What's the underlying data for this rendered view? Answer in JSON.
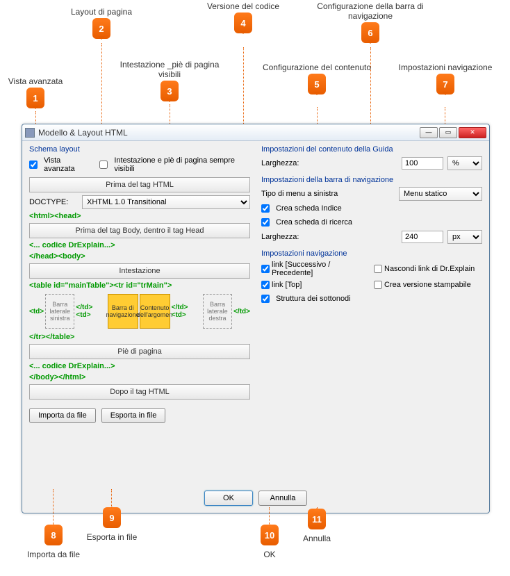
{
  "callouts": {
    "c1": {
      "num": "1",
      "label": "Vista avanzata"
    },
    "c2": {
      "num": "2",
      "label": "Layout di pagina"
    },
    "c3": {
      "num": "3",
      "label": "Intestazione _piè di pagina visibili"
    },
    "c4": {
      "num": "4",
      "label": "Versione del codice"
    },
    "c5": {
      "num": "5",
      "label": "Configurazione del contenuto"
    },
    "c6": {
      "num": "6",
      "label": "Configurazione della barra di navigazione"
    },
    "c7": {
      "num": "7",
      "label": "Impostazioni navigazione"
    },
    "c8": {
      "num": "8",
      "label": "Importa da file"
    },
    "c9": {
      "num": "9",
      "label": "Esporta in file"
    },
    "c10": {
      "num": "10",
      "label": "OK"
    },
    "c11": {
      "num": "11",
      "label": "Annulla"
    }
  },
  "window": {
    "title": "Modello & Layout HTML"
  },
  "left": {
    "fs_schema": "Schema layout",
    "chk_vista": "Vista avanzata",
    "chk_intest": "Intestazione e piè di pagina sempre visibili",
    "btn_prima": "Prima del tag HTML",
    "lbl_doctype": "DOCTYPE:",
    "doctype_val": "XHTML 1.0 Transitional",
    "code1": "<html><head>",
    "btn_prima_body": "Prima del tag Body, dentro il tag Head",
    "code2": "<... codice DrExplain...>",
    "code3": "</head><body>",
    "btn_intest": "Intestazione",
    "code4": "<table id=\"mainTable\"><tr id=\"trMain\">",
    "viz": {
      "td1": "<td>",
      "b1": "Barra laterale sinistra",
      "ctd1": "</td><td>",
      "b2": "Barra di navigazione",
      "b3": "Contenuto dell'argomen",
      "ctd2": "</td><td>",
      "b4": "Barra laterale destra",
      "ctd3": "</td>"
    },
    "code5": "</tr></table>",
    "btn_pie": "Piè di pagina",
    "code6": "<... codice DrExplain...>",
    "code7": "</body></html>",
    "btn_dopo": "Dopo il tag HTML",
    "btn_import": "Importa da file",
    "btn_export": "Esporta in file"
  },
  "right": {
    "fs_content": "Impostazioni del contenuto della Guida",
    "lbl_larg1": "Larghezza:",
    "val_larg1": "100",
    "unit_larg1": "%",
    "fs_nav": "Impostazioni della barra di navigazione",
    "lbl_menu": "Tipo di menu a sinistra",
    "val_menu": "Menu statico",
    "chk_indice": "Crea scheda Indice",
    "chk_ricerca": "Crea scheda di ricerca",
    "lbl_larg2": "Larghezza:",
    "val_larg2": "240",
    "unit_larg2": "px",
    "fs_navset": "Impostazioni navigazione",
    "chk_link_sp": "link [Successivo / Precedente]",
    "chk_nascondi": "Nascondi link di Dr.Explain",
    "chk_link_top": "link [Top]",
    "chk_stampa": "Crea versione stampabile",
    "chk_strutt": "Struttura dei sottonodi"
  },
  "footer": {
    "ok": "OK",
    "cancel": "Annulla"
  }
}
